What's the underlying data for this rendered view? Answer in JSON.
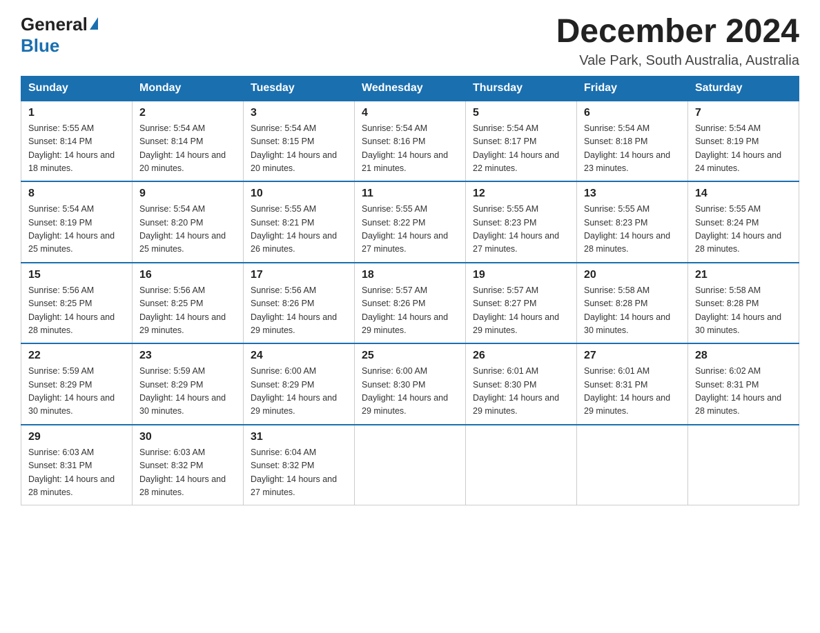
{
  "header": {
    "logo_general": "General",
    "logo_blue": "Blue",
    "month_title": "December 2024",
    "location": "Vale Park, South Australia, Australia"
  },
  "weekdays": [
    "Sunday",
    "Monday",
    "Tuesday",
    "Wednesday",
    "Thursday",
    "Friday",
    "Saturday"
  ],
  "weeks": [
    [
      {
        "day": "1",
        "sunrise": "Sunrise: 5:55 AM",
        "sunset": "Sunset: 8:14 PM",
        "daylight": "Daylight: 14 hours and 18 minutes."
      },
      {
        "day": "2",
        "sunrise": "Sunrise: 5:54 AM",
        "sunset": "Sunset: 8:14 PM",
        "daylight": "Daylight: 14 hours and 20 minutes."
      },
      {
        "day": "3",
        "sunrise": "Sunrise: 5:54 AM",
        "sunset": "Sunset: 8:15 PM",
        "daylight": "Daylight: 14 hours and 20 minutes."
      },
      {
        "day": "4",
        "sunrise": "Sunrise: 5:54 AM",
        "sunset": "Sunset: 8:16 PM",
        "daylight": "Daylight: 14 hours and 21 minutes."
      },
      {
        "day": "5",
        "sunrise": "Sunrise: 5:54 AM",
        "sunset": "Sunset: 8:17 PM",
        "daylight": "Daylight: 14 hours and 22 minutes."
      },
      {
        "day": "6",
        "sunrise": "Sunrise: 5:54 AM",
        "sunset": "Sunset: 8:18 PM",
        "daylight": "Daylight: 14 hours and 23 minutes."
      },
      {
        "day": "7",
        "sunrise": "Sunrise: 5:54 AM",
        "sunset": "Sunset: 8:19 PM",
        "daylight": "Daylight: 14 hours and 24 minutes."
      }
    ],
    [
      {
        "day": "8",
        "sunrise": "Sunrise: 5:54 AM",
        "sunset": "Sunset: 8:19 PM",
        "daylight": "Daylight: 14 hours and 25 minutes."
      },
      {
        "day": "9",
        "sunrise": "Sunrise: 5:54 AM",
        "sunset": "Sunset: 8:20 PM",
        "daylight": "Daylight: 14 hours and 25 minutes."
      },
      {
        "day": "10",
        "sunrise": "Sunrise: 5:55 AM",
        "sunset": "Sunset: 8:21 PM",
        "daylight": "Daylight: 14 hours and 26 minutes."
      },
      {
        "day": "11",
        "sunrise": "Sunrise: 5:55 AM",
        "sunset": "Sunset: 8:22 PM",
        "daylight": "Daylight: 14 hours and 27 minutes."
      },
      {
        "day": "12",
        "sunrise": "Sunrise: 5:55 AM",
        "sunset": "Sunset: 8:23 PM",
        "daylight": "Daylight: 14 hours and 27 minutes."
      },
      {
        "day": "13",
        "sunrise": "Sunrise: 5:55 AM",
        "sunset": "Sunset: 8:23 PM",
        "daylight": "Daylight: 14 hours and 28 minutes."
      },
      {
        "day": "14",
        "sunrise": "Sunrise: 5:55 AM",
        "sunset": "Sunset: 8:24 PM",
        "daylight": "Daylight: 14 hours and 28 minutes."
      }
    ],
    [
      {
        "day": "15",
        "sunrise": "Sunrise: 5:56 AM",
        "sunset": "Sunset: 8:25 PM",
        "daylight": "Daylight: 14 hours and 28 minutes."
      },
      {
        "day": "16",
        "sunrise": "Sunrise: 5:56 AM",
        "sunset": "Sunset: 8:25 PM",
        "daylight": "Daylight: 14 hours and 29 minutes."
      },
      {
        "day": "17",
        "sunrise": "Sunrise: 5:56 AM",
        "sunset": "Sunset: 8:26 PM",
        "daylight": "Daylight: 14 hours and 29 minutes."
      },
      {
        "day": "18",
        "sunrise": "Sunrise: 5:57 AM",
        "sunset": "Sunset: 8:26 PM",
        "daylight": "Daylight: 14 hours and 29 minutes."
      },
      {
        "day": "19",
        "sunrise": "Sunrise: 5:57 AM",
        "sunset": "Sunset: 8:27 PM",
        "daylight": "Daylight: 14 hours and 29 minutes."
      },
      {
        "day": "20",
        "sunrise": "Sunrise: 5:58 AM",
        "sunset": "Sunset: 8:28 PM",
        "daylight": "Daylight: 14 hours and 30 minutes."
      },
      {
        "day": "21",
        "sunrise": "Sunrise: 5:58 AM",
        "sunset": "Sunset: 8:28 PM",
        "daylight": "Daylight: 14 hours and 30 minutes."
      }
    ],
    [
      {
        "day": "22",
        "sunrise": "Sunrise: 5:59 AM",
        "sunset": "Sunset: 8:29 PM",
        "daylight": "Daylight: 14 hours and 30 minutes."
      },
      {
        "day": "23",
        "sunrise": "Sunrise: 5:59 AM",
        "sunset": "Sunset: 8:29 PM",
        "daylight": "Daylight: 14 hours and 30 minutes."
      },
      {
        "day": "24",
        "sunrise": "Sunrise: 6:00 AM",
        "sunset": "Sunset: 8:29 PM",
        "daylight": "Daylight: 14 hours and 29 minutes."
      },
      {
        "day": "25",
        "sunrise": "Sunrise: 6:00 AM",
        "sunset": "Sunset: 8:30 PM",
        "daylight": "Daylight: 14 hours and 29 minutes."
      },
      {
        "day": "26",
        "sunrise": "Sunrise: 6:01 AM",
        "sunset": "Sunset: 8:30 PM",
        "daylight": "Daylight: 14 hours and 29 minutes."
      },
      {
        "day": "27",
        "sunrise": "Sunrise: 6:01 AM",
        "sunset": "Sunset: 8:31 PM",
        "daylight": "Daylight: 14 hours and 29 minutes."
      },
      {
        "day": "28",
        "sunrise": "Sunrise: 6:02 AM",
        "sunset": "Sunset: 8:31 PM",
        "daylight": "Daylight: 14 hours and 28 minutes."
      }
    ],
    [
      {
        "day": "29",
        "sunrise": "Sunrise: 6:03 AM",
        "sunset": "Sunset: 8:31 PM",
        "daylight": "Daylight: 14 hours and 28 minutes."
      },
      {
        "day": "30",
        "sunrise": "Sunrise: 6:03 AM",
        "sunset": "Sunset: 8:32 PM",
        "daylight": "Daylight: 14 hours and 28 minutes."
      },
      {
        "day": "31",
        "sunrise": "Sunrise: 6:04 AM",
        "sunset": "Sunset: 8:32 PM",
        "daylight": "Daylight: 14 hours and 27 minutes."
      },
      null,
      null,
      null,
      null
    ]
  ]
}
